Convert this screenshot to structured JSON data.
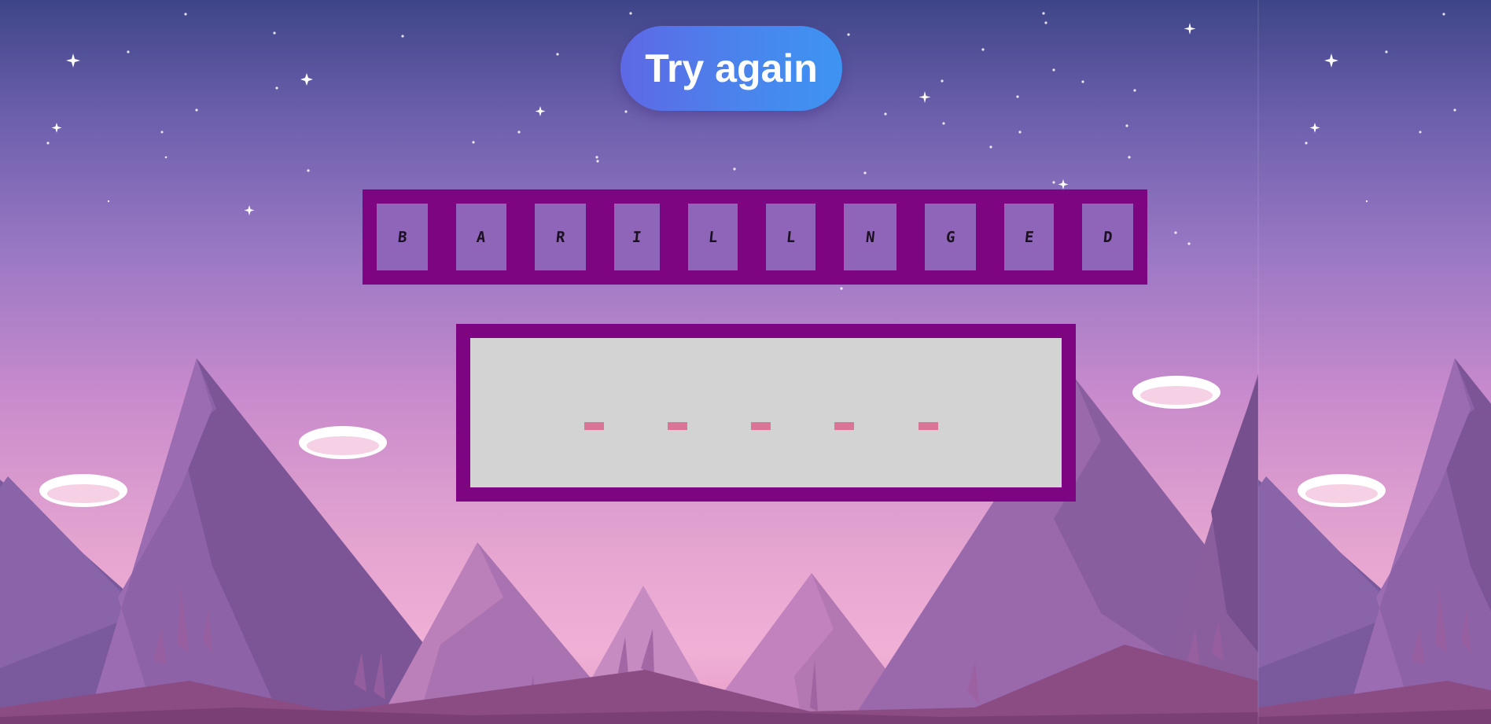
{
  "game": {
    "try_again_label": "Try again",
    "letters": [
      "B",
      "A",
      "R",
      "I",
      "L",
      "L",
      "N",
      "G",
      "E",
      "D"
    ],
    "answer_length": 5
  },
  "colors": {
    "sky_top": "#3e4588",
    "sky_mid": "#9a78c4",
    "sky_bottom": "#f0a9d3",
    "tray_border": "#7e0582",
    "tile_fill": "#8e65b8",
    "board_fill": "#d3d3d3",
    "slot_color": "#dc7498",
    "button_start": "#5e68e6",
    "button_end": "#3d94f2"
  },
  "icons": {
    "star": "sparkle-star",
    "cloud": "cloud-puff"
  }
}
